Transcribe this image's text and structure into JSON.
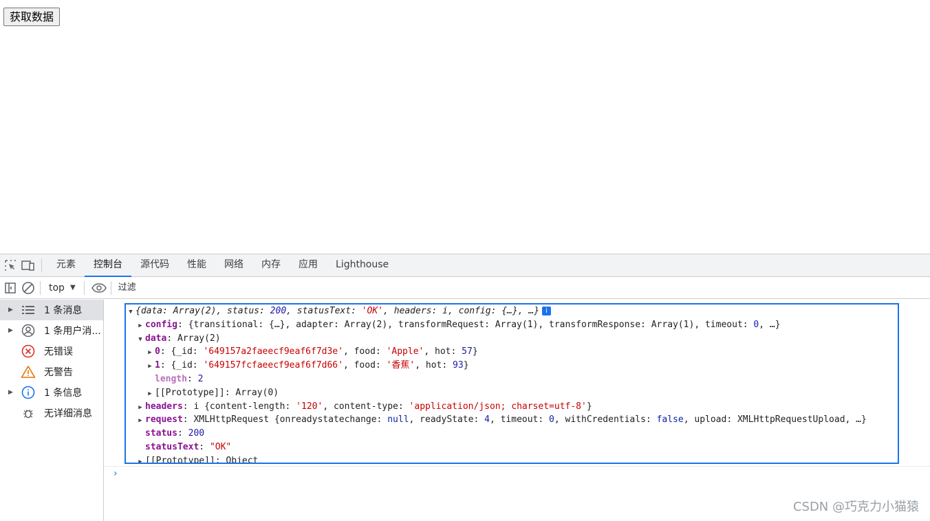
{
  "page": {
    "fetch_button_label": "获取数据"
  },
  "devtools": {
    "tabs": [
      "元素",
      "控制台",
      "源代码",
      "性能",
      "网络",
      "内存",
      "应用",
      "Lighthouse"
    ],
    "active_tab": "控制台",
    "context": "top",
    "filter_placeholder": "过滤",
    "sidebar": [
      {
        "label": "1 条消息",
        "icon": "list-icon"
      },
      {
        "label": "1 条用户消...",
        "icon": "user-icon"
      },
      {
        "label": "无错误",
        "icon": "error-icon"
      },
      {
        "label": "无警告",
        "icon": "warning-icon"
      },
      {
        "label": "1 条信息",
        "icon": "info-icon"
      },
      {
        "label": "无详细消息",
        "icon": "bug-icon"
      }
    ]
  },
  "log": {
    "summary": {
      "p1": "{data: Array(2), status: ",
      "status": "200",
      "p2": ", statusText: ",
      "statusText": "'OK'",
      "p3": ", headers: i, config: {…}, …}"
    },
    "config": {
      "key": "config",
      "preview_a": ": {transitional: {…}, adapter: Array(2), transformRequest: Array(1), transformResponse: Array(1), timeout: ",
      "timeout": "0",
      "preview_b": ", …}"
    },
    "data": {
      "key": "data",
      "preview": ": Array(2)"
    },
    "item0": {
      "key": "0",
      "a": ": {_id: ",
      "id": "'649157a2faeecf9eaf6f7d3e'",
      "b": ", food: ",
      "food": "'Apple'",
      "c": ", hot: ",
      "hot": "57",
      "d": "}"
    },
    "item1": {
      "key": "1",
      "a": ": {_id: ",
      "id": "'649157fcfaeecf9eaf6f7d66'",
      "b": ", food: ",
      "food": "'香蕉'",
      "c": ", hot: ",
      "hot": "93",
      "d": "}"
    },
    "length": {
      "key": "length",
      "sep": ": ",
      "value": "2"
    },
    "data_proto": {
      "key": "[[Prototype]]",
      "value": ": Array(0)"
    },
    "headers": {
      "key": "headers",
      "a": ": i {content-length: ",
      "len": "'120'",
      "b": ", content-type: ",
      "type": "'application/json; charset=utf-8'",
      "c": "}"
    },
    "request": {
      "key": "request",
      "a": ": XMLHttpRequest {onreadystatechange: ",
      "null": "null",
      "b": ", readyState: ",
      "rs": "4",
      "c": ", timeout: ",
      "to": "0",
      "d": ", withCredentials: ",
      "wc": "false",
      "e": ", upload: XMLHttpRequestUpload, …}"
    },
    "status": {
      "key": "status",
      "sep": ": ",
      "value": "200"
    },
    "statusText": {
      "key": "statusText",
      "sep": ": ",
      "value": "\"OK\""
    },
    "proto": {
      "key": "[[Prototype]]",
      "value": ": Object"
    }
  },
  "watermark": "CSDN @巧克力小猫猿",
  "colors": {
    "accent": "#1a73e8",
    "string": "#c80000",
    "number": "#1a1aa6",
    "key": "#881391"
  }
}
